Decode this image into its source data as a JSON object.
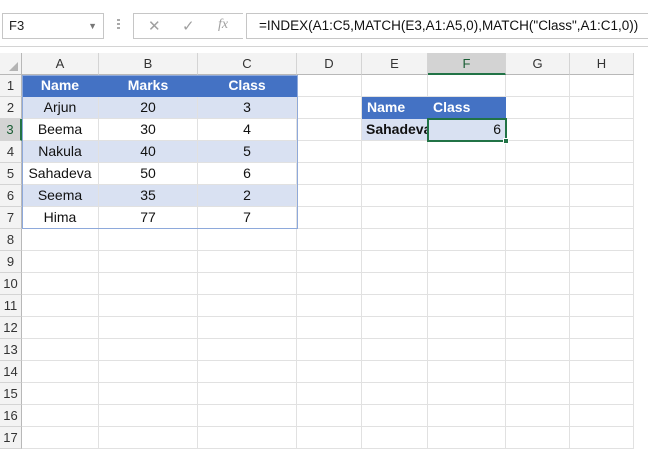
{
  "formula_bar": {
    "name_box": "F3",
    "cancel_glyph": "✕",
    "enter_glyph": "✓",
    "fx_label": "fx",
    "formula": "=INDEX(A1:C5,MATCH(E3,A1:A5,0),MATCH(\"Class\",A1:C1,0))"
  },
  "columns": [
    "A",
    "B",
    "C",
    "D",
    "E",
    "F",
    "G",
    "H"
  ],
  "rows": [
    "1",
    "2",
    "3",
    "4",
    "5",
    "6",
    "7",
    "8",
    "9",
    "10",
    "11",
    "12",
    "13",
    "14",
    "15",
    "16",
    "17"
  ],
  "table": {
    "headers": [
      "Name",
      "Marks",
      "Class"
    ],
    "data": [
      [
        "Arjun",
        "20",
        "3"
      ],
      [
        "Beema",
        "30",
        "4"
      ],
      [
        "Nakula",
        "40",
        "5"
      ],
      [
        "Sahadeva",
        "50",
        "6"
      ],
      [
        "Seema",
        "35",
        "2"
      ],
      [
        "Hima",
        "77",
        "7"
      ]
    ]
  },
  "lookup": {
    "header_name": "Name",
    "header_class": "Class",
    "name_value": "Sahadeva",
    "result": "6"
  },
  "selection": {
    "cell": "F3",
    "column": "F",
    "row": "3"
  },
  "colors": {
    "header_fill": "#4472c4",
    "band_fill": "#d9e1f2",
    "selection": "#217346"
  }
}
